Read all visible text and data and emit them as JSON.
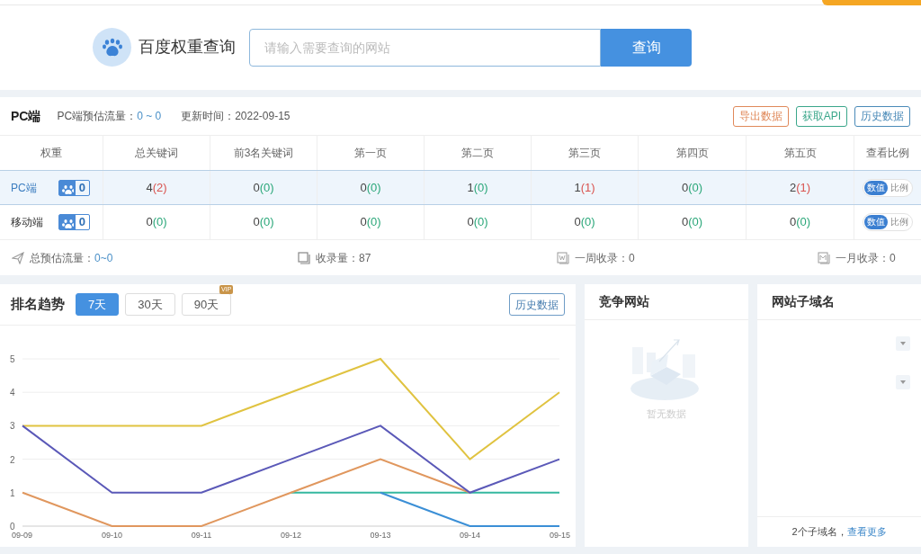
{
  "search": {
    "brand": "百度权重查询",
    "placeholder": "请输入需要查询的网站",
    "button": "查询"
  },
  "summary": {
    "title": "PC端",
    "traffic_label": "PC端预估流量：",
    "traffic_value": "0 ~ 0",
    "updated": "更新时间：2022-09-15",
    "buttons": [
      {
        "label": "导出数据",
        "color": "#e0895a"
      },
      {
        "label": "获取API",
        "color": "#3aa68a"
      },
      {
        "label": "历史数据",
        "color": "#4a8ab8"
      }
    ],
    "columns": [
      "权重",
      "总关键词",
      "前3名关键词",
      "第一页",
      "第二页",
      "第三页",
      "第四页",
      "第五页",
      "查看比例"
    ],
    "rows": [
      {
        "selected": true,
        "cells": [
          {
            "kind": "weight",
            "label": "PC端",
            "weight": "0"
          },
          {
            "kind": "count",
            "value": "4",
            "extra": "(2)",
            "color": "#d9534f"
          },
          {
            "kind": "count",
            "value": "0",
            "extra": "(0)",
            "color": "#2aa779"
          },
          {
            "kind": "count",
            "value": "0",
            "extra": "(0)",
            "color": "#2aa779"
          },
          {
            "kind": "count",
            "value": "1",
            "extra": "(0)",
            "color": "#2aa779"
          },
          {
            "kind": "count",
            "value": "1",
            "extra": "(1)",
            "color": "#d9534f"
          },
          {
            "kind": "count",
            "value": "0",
            "extra": "(0)",
            "color": "#2aa779"
          },
          {
            "kind": "count",
            "value": "2",
            "extra": "(1)",
            "color": "#d9534f"
          },
          {
            "kind": "toggle",
            "options": [
              {
                "label": "数值",
                "selected": true
              },
              {
                "label": "比例",
                "selected": false
              }
            ]
          }
        ]
      },
      {
        "selected": false,
        "cells": [
          {
            "kind": "weight",
            "label": "移动端",
            "weight": "0"
          },
          {
            "kind": "count",
            "value": "0",
            "extra": "(0)",
            "color": "#2aa779"
          },
          {
            "kind": "count",
            "value": "0",
            "extra": "(0)",
            "color": "#2aa779"
          },
          {
            "kind": "count",
            "value": "0",
            "extra": "(0)",
            "color": "#2aa779"
          },
          {
            "kind": "count",
            "value": "0",
            "extra": "(0)",
            "color": "#2aa779"
          },
          {
            "kind": "count",
            "value": "0",
            "extra": "(0)",
            "color": "#2aa779"
          },
          {
            "kind": "count",
            "value": "0",
            "extra": "(0)",
            "color": "#2aa779"
          },
          {
            "kind": "count",
            "value": "0",
            "extra": "(0)",
            "color": "#2aa779"
          },
          {
            "kind": "toggle",
            "options": [
              {
                "label": "数值",
                "selected": true
              },
              {
                "label": "比例",
                "selected": false
              }
            ]
          }
        ]
      }
    ],
    "stats": [
      {
        "kind": "send",
        "label": "总预估流量：",
        "value": "0~0"
      },
      {
        "kind": "copy",
        "label": "收录量：",
        "value": "87"
      },
      {
        "kind": "week",
        "label": "一周收录：",
        "value": "0"
      },
      {
        "kind": "month",
        "label": "一月收录：",
        "value": "0"
      }
    ]
  },
  "trend": {
    "title": "排名趋势",
    "ranges": [
      {
        "label": "7天",
        "selected": true,
        "vip": false
      },
      {
        "label": "30天",
        "selected": false,
        "vip": false
      },
      {
        "label": "90天",
        "selected": false,
        "vip": true
      }
    ],
    "vip_label": "VIP",
    "history_button": "历史数据",
    "chart_data": {
      "type": "line",
      "grid": true,
      "categories": [
        "09-09",
        "09-10",
        "09-11",
        "09-12",
        "09-13",
        "09-14",
        "09-15"
      ],
      "ylim": [
        0,
        5
      ],
      "yticks": [
        0,
        1,
        2,
        3,
        4,
        5
      ],
      "series": [
        {
          "color": "#35b8a0",
          "values": [
            null,
            null,
            null,
            1,
            1,
            1,
            1
          ]
        },
        {
          "color": "#3b8fd6",
          "values": [
            null,
            null,
            null,
            null,
            1,
            0,
            0
          ]
        },
        {
          "color": "#e0c341",
          "values": [
            3,
            3,
            3,
            4,
            5,
            2,
            4
          ]
        },
        {
          "color": "#e0975e",
          "values": [
            1,
            0,
            0,
            1,
            2,
            1,
            null
          ]
        },
        {
          "color": "#5b59b8",
          "values": [
            3,
            1,
            1,
            2,
            3,
            1,
            2
          ]
        }
      ]
    }
  },
  "competitors": {
    "title": "竞争网站",
    "empty": "暂无数据"
  },
  "subdomains": {
    "title": "网站子域名",
    "count": "2个子域名，",
    "more": "查看更多"
  }
}
